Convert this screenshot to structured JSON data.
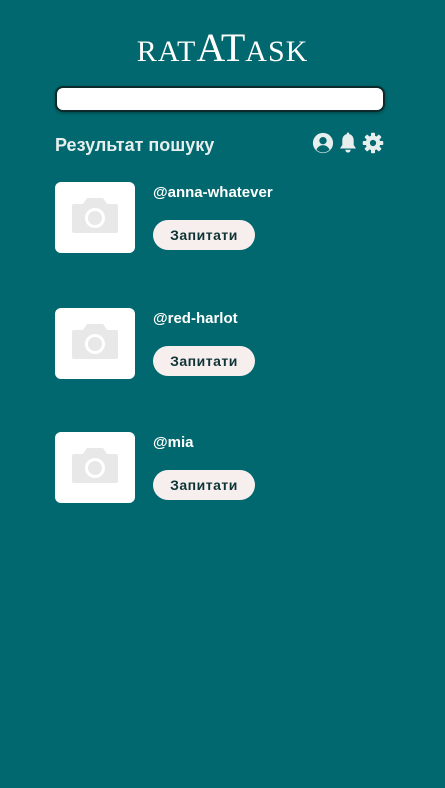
{
  "app": {
    "logo_part1": "RAT",
    "logo_part2": "AT",
    "logo_part3": "ASK"
  },
  "search": {
    "value": "",
    "placeholder": ""
  },
  "results": {
    "title": "Результат пошуку",
    "items": [
      {
        "username": "@anna-whatever",
        "ask_label": "Запитати",
        "photo_icon": "camera-icon"
      },
      {
        "username": "@red-harlot",
        "ask_label": "Запитати",
        "photo_icon": "camera-icon"
      },
      {
        "username": "@mia",
        "ask_label": "Запитати",
        "photo_icon": "camera-icon"
      }
    ]
  },
  "header_icons": [
    "user-circle-icon",
    "bell-icon",
    "gear-icon"
  ],
  "colors": {
    "background": "#00686e",
    "button_bg": "#f7eeee",
    "button_text": "#0f3436",
    "photo_placeholder": "#e8e8e8"
  }
}
